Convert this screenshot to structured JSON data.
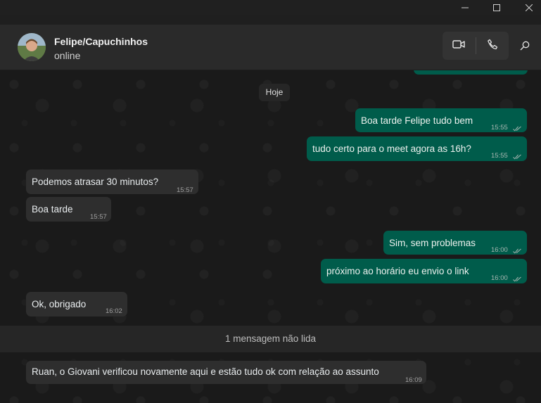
{
  "window": {
    "minimize_icon": "minimize-icon",
    "maximize_icon": "maximize-icon",
    "close_icon": "close-icon"
  },
  "header": {
    "contact_name": "Felipe/Capuchinhos",
    "status": "online",
    "video_icon": "video-call-icon",
    "voice_icon": "phone-icon",
    "search_icon": "search-icon"
  },
  "chat": {
    "date_separator": "Hoje",
    "unread_label": "1 mensagem não lida",
    "messages": [
      {
        "direction": "out",
        "text": "Boa tarde Felipe tudo bem",
        "time": "15:55",
        "status": "read"
      },
      {
        "direction": "out",
        "text": "tudo certo para o meet agora as 16h?",
        "time": "15:55",
        "status": "read"
      },
      {
        "direction": "in",
        "text": "Podemos atrasar 30 minutos?",
        "time": "15:57"
      },
      {
        "direction": "in",
        "text": "Boa tarde",
        "time": "15:57"
      },
      {
        "direction": "out",
        "text": "Sim, sem problemas",
        "time": "16:00",
        "status": "read"
      },
      {
        "direction": "out",
        "text": "próximo ao horário eu envio o link",
        "time": "16:00",
        "status": "read"
      },
      {
        "direction": "in",
        "text": "Ok, obrigado",
        "time": "16:02"
      },
      {
        "direction": "in",
        "text": "Ruan, o Giovani verificou novamente aqui e estão tudo ok com relação ao assunto",
        "time": "16:09"
      }
    ]
  },
  "colors": {
    "outgoing_bubble": "#005c4b",
    "incoming_bubble": "#2e2e2e",
    "background": "#1a1a1a"
  }
}
